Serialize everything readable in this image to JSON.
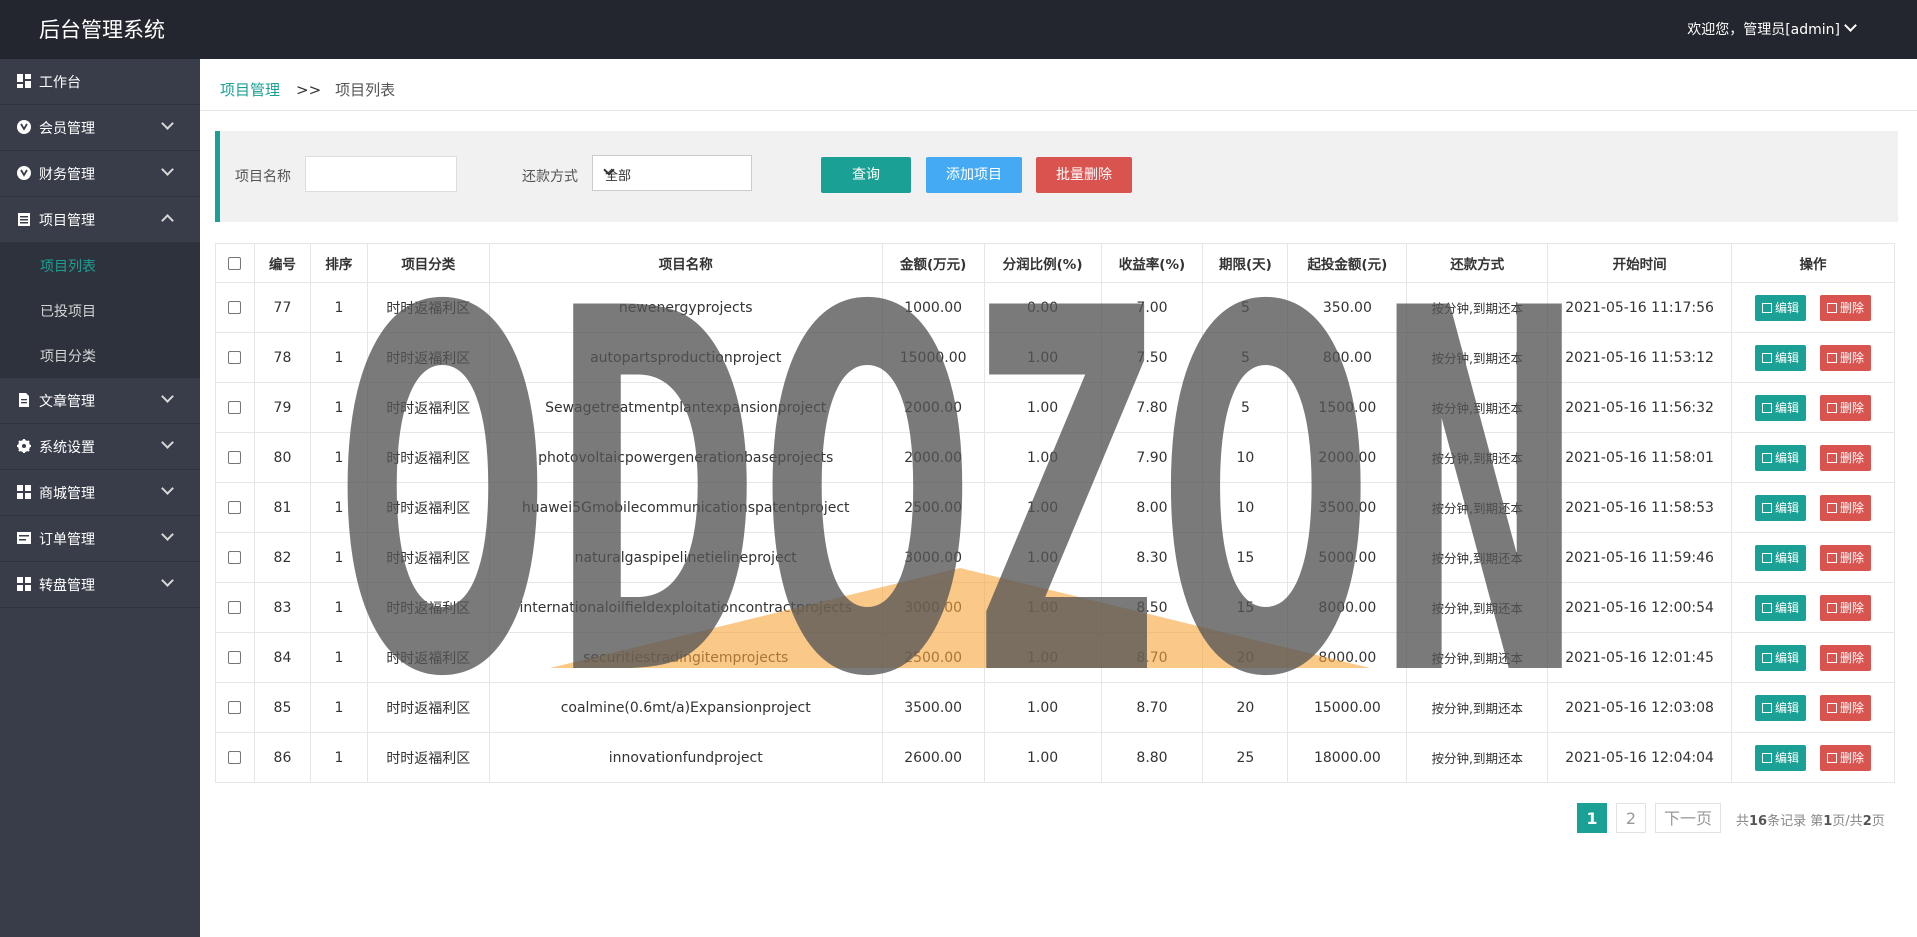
{
  "header": {
    "brand": "后台管理系统",
    "user_greeting": "欢迎您，管理员[admin]"
  },
  "sidebar": {
    "items": [
      {
        "label": "工作台",
        "icon": "dashboard-icon"
      },
      {
        "label": "会员管理",
        "icon": "member-icon"
      },
      {
        "label": "财务管理",
        "icon": "finance-icon"
      },
      {
        "label": "项目管理",
        "icon": "clipboard-icon"
      },
      {
        "label": "文章管理",
        "icon": "document-icon"
      },
      {
        "label": "系统设置",
        "icon": "gear-icon"
      },
      {
        "label": "商城管理",
        "icon": "grid-icon"
      },
      {
        "label": "订单管理",
        "icon": "order-icon"
      },
      {
        "label": "转盘管理",
        "icon": "grid-icon"
      }
    ],
    "sub_items": [
      "项目列表",
      "已投项目",
      "项目分类"
    ]
  },
  "breadcrumb": {
    "parent": "项目管理",
    "separator": ">>",
    "current": "项目列表"
  },
  "search": {
    "name_label": "项目名称",
    "name_value": "",
    "repay_label": "还款方式",
    "repay_selected": "全部",
    "query_label": "查询",
    "add_label": "添加项目",
    "batch_delete_label": "批量删除"
  },
  "table": {
    "headers": [
      "编号",
      "排序",
      "项目分类",
      "项目名称",
      "金额(万元)",
      "分润比例(%)",
      "收益率(%)",
      "期限(天)",
      "起投金额(元)",
      "还款方式",
      "开始时间",
      "操作"
    ],
    "edit_label": "编辑",
    "delete_label": "删除",
    "rows": [
      [
        "77",
        "1",
        "时时返福利区",
        "newenergyprojects",
        "1000.00",
        "0.00",
        "7.00",
        "5",
        "350.00",
        "按分钟,到期还本",
        "2021-05-16 11:17:56"
      ],
      [
        "78",
        "1",
        "时时返福利区",
        "autopartsproductionproject",
        "15000.00",
        "1.00",
        "7.50",
        "5",
        "800.00",
        "按分钟,到期还本",
        "2021-05-16 11:53:12"
      ],
      [
        "79",
        "1",
        "时时返福利区",
        "Sewagetreatmentplantexpansionproject",
        "2000.00",
        "1.00",
        "7.80",
        "5",
        "1500.00",
        "按分钟,到期还本",
        "2021-05-16 11:56:32"
      ],
      [
        "80",
        "1",
        "时时返福利区",
        "photovoltaicpowergenerationbaseprojects",
        "2000.00",
        "1.00",
        "7.90",
        "10",
        "2000.00",
        "按分钟,到期还本",
        "2021-05-16 11:58:01"
      ],
      [
        "81",
        "1",
        "时时返福利区",
        "huawei5Gmobilecommunicationspatentproject",
        "2500.00",
        "1.00",
        "8.00",
        "10",
        "3500.00",
        "按分钟,到期还本",
        "2021-05-16 11:58:53"
      ],
      [
        "82",
        "1",
        "时时返福利区",
        "naturalgaspipelinetielineproject",
        "3000.00",
        "1.00",
        "8.30",
        "15",
        "5000.00",
        "按分钟,到期还本",
        "2021-05-16 11:59:46"
      ],
      [
        "83",
        "1",
        "时时返福利区",
        "internationaloilfieldexploitationcontractprojects",
        "3000.00",
        "1.00",
        "8.50",
        "15",
        "8000.00",
        "按分钟,到期还本",
        "2021-05-16 12:00:54"
      ],
      [
        "84",
        "1",
        "时时返福利区",
        "securitiestradingitemprojects",
        "2500.00",
        "1.00",
        "8.70",
        "20",
        "8000.00",
        "按分钟,到期还本",
        "2021-05-16 12:01:45"
      ],
      [
        "85",
        "1",
        "时时返福利区",
        "coalmine(0.6mt/a)Expansionproject",
        "3500.00",
        "1.00",
        "8.70",
        "20",
        "15000.00",
        "按分钟,到期还本",
        "2021-05-16 12:03:08"
      ],
      [
        "86",
        "1",
        "时时返福利区",
        "innovationfundproject",
        "2600.00",
        "1.00",
        "8.80",
        "25",
        "18000.00",
        "按分钟,到期还本",
        "2021-05-16 12:04:04"
      ]
    ]
  },
  "pagination": {
    "pages": [
      "1",
      "2"
    ],
    "current": "1",
    "next_label": "下一页",
    "total_prefix": "共",
    "total_count": "16",
    "total_suffix": "条记录 第",
    "current_page": "1",
    "page_mid": "页/共",
    "total_pages": "2",
    "page_end": "页"
  },
  "watermark": {
    "text": "ODOZON"
  },
  "colors": {
    "topbar": "#23262e",
    "sidebar": "#393d49",
    "accent": "#1aa094",
    "blue": "#44aaf4",
    "red": "#d9534f"
  }
}
